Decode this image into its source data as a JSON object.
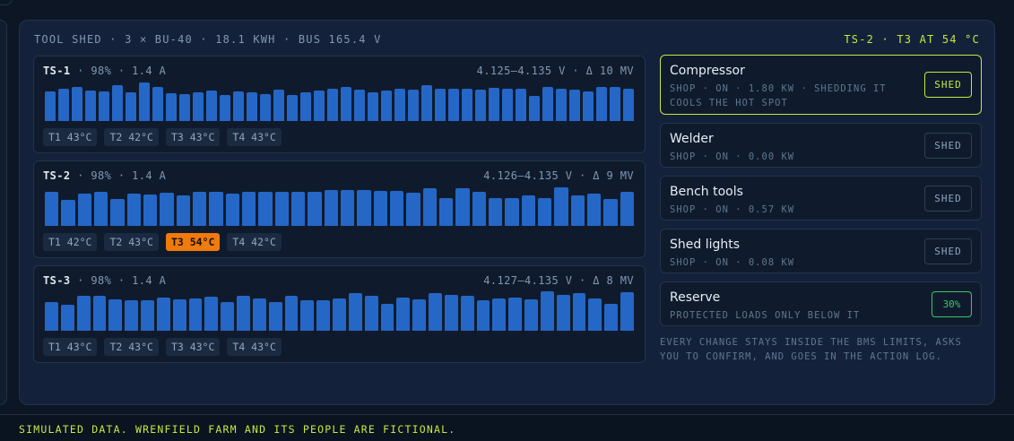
{
  "header": {
    "summary": "Tool shed · 3 × BU-40 · 18.1 kWh · bus 165.4 V",
    "alert": "TS-2 · T3 at 54 °C"
  },
  "strings": [
    {
      "name": "TS-1",
      "stats": " · 98% · 1.4 A",
      "range": "4.125–4.135 V · Δ 10 mV",
      "cells": [
        0.72,
        0.78,
        0.82,
        0.75,
        0.72,
        0.86,
        0.7,
        0.94,
        0.82,
        0.68,
        0.65,
        0.7,
        0.74,
        0.63,
        0.71,
        0.69,
        0.66,
        0.76,
        0.62,
        0.7,
        0.74,
        0.79,
        0.82,
        0.76,
        0.7,
        0.74,
        0.78,
        0.76,
        0.86,
        0.79,
        0.79,
        0.79,
        0.77,
        0.8,
        0.78,
        0.78,
        0.61,
        0.82,
        0.79,
        0.76,
        0.72,
        0.83,
        0.83,
        0.78
      ],
      "temps": [
        {
          "label": "T1 43°C",
          "hot": false
        },
        {
          "label": "T2 42°C",
          "hot": false
        },
        {
          "label": "T3 43°C",
          "hot": false
        },
        {
          "label": "T4 43°C",
          "hot": false
        }
      ]
    },
    {
      "name": "TS-2",
      "stats": " · 98% · 1.4 A",
      "range": "4.126–4.135 V · Δ 9 mV",
      "cells": [
        0.83,
        0.64,
        0.78,
        0.82,
        0.66,
        0.78,
        0.77,
        0.81,
        0.73,
        0.83,
        0.83,
        0.79,
        0.83,
        0.83,
        0.82,
        0.83,
        0.82,
        0.86,
        0.86,
        0.86,
        0.85,
        0.84,
        0.8,
        0.91,
        0.68,
        0.91,
        0.83,
        0.67,
        0.67,
        0.73,
        0.67,
        0.93,
        0.73,
        0.78,
        0.65,
        0.82
      ],
      "temps": [
        {
          "label": "T1 42°C",
          "hot": false
        },
        {
          "label": "T2 43°C",
          "hot": false
        },
        {
          "label": "T3 54°C",
          "hot": true
        },
        {
          "label": "T4 42°C",
          "hot": false
        }
      ]
    },
    {
      "name": "TS-3",
      "stats": " · 98% · 1.4 A",
      "range": "4.127–4.135 V · Δ 8 mV",
      "cells": [
        0.69,
        0.64,
        0.84,
        0.84,
        0.77,
        0.75,
        0.74,
        0.81,
        0.76,
        0.78,
        0.82,
        0.69,
        0.84,
        0.79,
        0.69,
        0.84,
        0.75,
        0.74,
        0.79,
        0.92,
        0.85,
        0.66,
        0.81,
        0.76,
        0.91,
        0.86,
        0.84,
        0.73,
        0.78,
        0.8,
        0.77,
        0.95,
        0.87,
        0.91,
        0.79,
        0.66,
        0.94
      ],
      "temps": [
        {
          "label": "T1 43°C",
          "hot": false
        },
        {
          "label": "T2 43°C",
          "hot": false
        },
        {
          "label": "T3 43°C",
          "hot": false
        },
        {
          "label": "T4 43°C",
          "hot": false
        }
      ]
    }
  ],
  "loads": [
    {
      "name": "Compressor",
      "detail": "Shop · on · 1.80 kW · shedding it cools the hot spot",
      "button": "Shed",
      "active": true
    },
    {
      "name": "Welder",
      "detail": "Shop · on · 0.00 kW",
      "button": "Shed",
      "active": false
    },
    {
      "name": "Bench tools",
      "detail": "Shop · on · 0.57 kW",
      "button": "Shed",
      "active": false
    },
    {
      "name": "Shed lights",
      "detail": "Shop · on · 0.08 kW",
      "button": "Shed",
      "active": false
    }
  ],
  "reserve": {
    "name": "Reserve",
    "detail": "Protected loads only below it",
    "value": "30%"
  },
  "note": "Every change stays inside the BMS limits, asks you to confirm, and goes in the action log.",
  "footer": "Simulated data. Wrenfield Farm and its people are fictional.",
  "colors": {
    "accent": "#c6e83e",
    "bar": "#2567c7",
    "hot": "#f07a0a",
    "ok": "#3ec46a"
  }
}
